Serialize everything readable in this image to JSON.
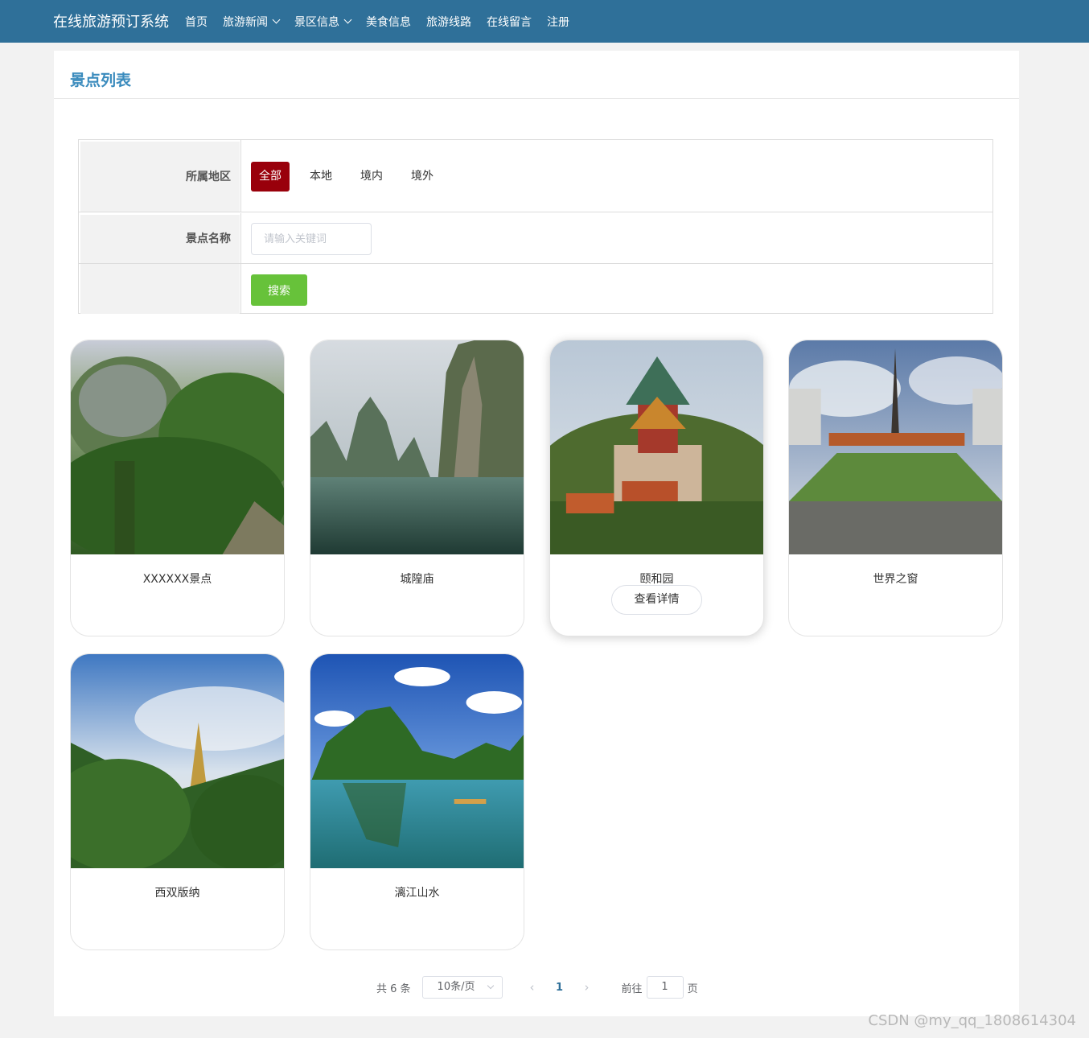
{
  "header": {
    "brand": "在线旅游预订系统",
    "nav": [
      {
        "label": "首页"
      },
      {
        "label": "旅游新闻"
      },
      {
        "label": "景区信息"
      },
      {
        "label": "美食信息"
      },
      {
        "label": "旅游线路"
      },
      {
        "label": "在线留言"
      },
      {
        "label": "注册"
      }
    ]
  },
  "panel": {
    "title": "景点列表"
  },
  "filter": {
    "region_label": "所属地区",
    "regions": [
      "全部",
      "本地",
      "境内",
      "境外"
    ],
    "selected_region": "全部",
    "name_label": "景点名称",
    "name_placeholder": "请输入关键词",
    "name_value": "",
    "search_label": "搜索"
  },
  "spots": [
    {
      "name": "XXXXXX景点",
      "image": "forest-path-photo"
    },
    {
      "name": "城隍庙",
      "image": "karst-lake-photo"
    },
    {
      "name": "颐和园",
      "image": "summer-palace-photo"
    },
    {
      "name": "世界之窗",
      "image": "eiffel-park-photo"
    },
    {
      "name": "西双版纳",
      "image": "pagoda-jungle-photo"
    },
    {
      "name": "漓江山水",
      "image": "li-river-photo"
    }
  ],
  "detail_button_label": "查看详情",
  "pagination": {
    "total": "共 6 条",
    "page_size": "10条/页",
    "current_page": "1",
    "goto_prefix": "前往",
    "goto_value": "1",
    "goto_suffix": "页"
  },
  "watermark": "CSDN @my_qq_1808614304"
}
